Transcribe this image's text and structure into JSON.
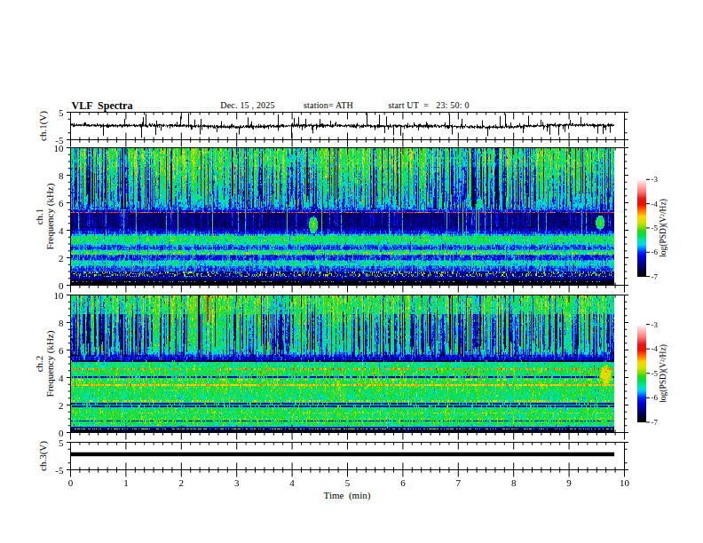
{
  "header": {
    "title": "VLF  Spectra",
    "date": "Dec. 15 , 2025",
    "station": "station= ATH",
    "start_ut": "start UT  =   23: 50: 0"
  },
  "x_axis": {
    "label": "Time  (min)",
    "min": 0,
    "max": 10,
    "tick_labels": [
      "0",
      "1",
      "2",
      "3",
      "4",
      "5",
      "6",
      "7",
      "8",
      "9",
      "10"
    ],
    "major_tick_interval_min": 1,
    "minor_ticks_per_major": 6,
    "data_end_min": 9.81
  },
  "panels": [
    {
      "id": "ch1-waveform",
      "ylabel": "ch.1(V)",
      "y_range": [
        -5,
        5
      ],
      "ytick_values": [
        5,
        -5
      ],
      "ytick_labels": [
        "5",
        "-5"
      ],
      "yminor_values": [
        2.5,
        -2.5
      ],
      "type": "line"
    },
    {
      "id": "ch1-spectrogram",
      "ylabel_lines": [
        "ch.1",
        "Frequency  (kHz)"
      ],
      "y_range": [
        0,
        10
      ],
      "ytick_values": [
        10,
        8,
        6,
        4,
        2,
        0
      ],
      "ytick_labels": [
        "10",
        "8",
        "6",
        "4",
        "2",
        "0"
      ],
      "yminor_interval_kHz": 0.5,
      "type": "heatmap"
    },
    {
      "id": "ch2-spectrogram",
      "ylabel_lines": [
        "ch.2",
        "Frequency  (kHz)"
      ],
      "y_range": [
        0,
        10
      ],
      "ytick_values": [
        10,
        8,
        6,
        4,
        2,
        0
      ],
      "ytick_labels": [
        "10",
        "8",
        "6",
        "4",
        "2",
        "0"
      ],
      "yminor_interval_kHz": 0.5,
      "type": "heatmap"
    },
    {
      "id": "ch3-waveform",
      "ylabel": "ch.3(V)",
      "y_range": [
        -5,
        5
      ],
      "ytick_values": [
        5,
        -5
      ],
      "ytick_labels": [
        "5",
        "-5"
      ],
      "yminor_values": [
        2.5,
        -2.5
      ],
      "type": "line"
    }
  ],
  "colorbars": [
    {
      "for_panel": "ch1-spectrogram",
      "label": "log(PSD)(V²/Hz)",
      "tick_values": [
        -3,
        -4,
        -5,
        -6,
        -7
      ],
      "tick_labels": [
        "-3",
        "-4",
        "-5",
        "-6",
        "-7"
      ],
      "range": [
        -7,
        -3
      ]
    },
    {
      "for_panel": "ch2-spectrogram",
      "label": "log(PSD)(V²/Hz)",
      "tick_values": [
        -3,
        -4,
        -5,
        -6,
        -7
      ],
      "tick_labels": [
        "-3",
        "-4",
        "-5",
        "-6",
        "-7"
      ],
      "range": [
        -7,
        -3
      ]
    }
  ],
  "colormap": {
    "range": [
      -7,
      -3
    ],
    "stops": [
      [
        0.0,
        "#000000"
      ],
      [
        0.06,
        "#02003c"
      ],
      [
        0.125,
        "#000085"
      ],
      [
        0.2,
        "#0000e0"
      ],
      [
        0.25,
        "#0028ff"
      ],
      [
        0.3,
        "#00a0ff"
      ],
      [
        0.33,
        "#00d8f0"
      ],
      [
        0.375,
        "#00e8a0"
      ],
      [
        0.425,
        "#00e050"
      ],
      [
        0.475,
        "#30d818"
      ],
      [
        0.5,
        "#78dc00"
      ],
      [
        0.563,
        "#d8e400"
      ],
      [
        0.625,
        "#ffd000"
      ],
      [
        0.65,
        "#ffa000"
      ],
      [
        0.7,
        "#ff5000"
      ],
      [
        0.74,
        "#f01000"
      ],
      [
        0.8,
        "#e01818"
      ],
      [
        0.875,
        "#ff7878"
      ],
      [
        0.95,
        "#ffc0c0"
      ],
      [
        1.0,
        "#fff8f8"
      ]
    ]
  },
  "chart_data": [
    {
      "id": "ch1-waveform",
      "type": "line",
      "x_range_min": [
        0,
        10
      ],
      "data_duration_min": 9.81,
      "y_range_V": [
        -5,
        5
      ],
      "baseline_mean_V": 0,
      "noise_sigma_V": 0.3,
      "baseline_wander": [
        {
          "amp_V": 0.28,
          "period_min": 4.7,
          "phase": 1.0
        },
        {
          "amp_V": 0.18,
          "period_min": 2.3,
          "phase": 2.5
        },
        {
          "amp_V": 0.12,
          "period_min": 7.9,
          "phase": 0.3
        }
      ],
      "random_spike_rate_per_min": 13,
      "major_spikes": [
        {
          "t": 1.26,
          "v": -4.5
        },
        {
          "t": 1.35,
          "v": 4.6
        },
        {
          "t": 1.53,
          "v": -3.4
        },
        {
          "t": 2.11,
          "v": 4.8
        },
        {
          "t": 3.03,
          "v": -3.2
        },
        {
          "t": 3.73,
          "v": 4.4
        },
        {
          "t": 3.98,
          "v": -4.6
        },
        {
          "t": 5.33,
          "v": 4.9
        },
        {
          "t": 5.56,
          "v": 4.3
        },
        {
          "t": 5.94,
          "v": -3.6
        },
        {
          "t": 6.82,
          "v": 4.5
        },
        {
          "t": 6.88,
          "v": -3.2
        },
        {
          "t": 7.52,
          "v": -3.8
        },
        {
          "t": 7.84,
          "v": 4.6
        },
        {
          "t": 8.25,
          "v": 3.9
        },
        {
          "t": 8.8,
          "v": -3.5
        },
        {
          "t": 9.2,
          "v": 3.4
        },
        {
          "t": 9.5,
          "v": -2.8
        }
      ]
    },
    {
      "id": "ch1-spectrogram",
      "type": "heatmap",
      "x_range_min": [
        0,
        10
      ],
      "data_duration_min": 9.81,
      "y_range_kHz": [
        0,
        10
      ],
      "z_range_log_psd": [
        -7,
        -3
      ],
      "background_profile_f_v": [
        [
          0.0,
          -7.0
        ],
        [
          0.18,
          -7.0
        ],
        [
          0.32,
          -6.85
        ],
        [
          0.45,
          -6.55
        ],
        [
          0.55,
          -6.3
        ],
        [
          0.62,
          -6.15
        ],
        [
          0.75,
          -6.0
        ],
        [
          0.95,
          -5.95
        ],
        [
          1.12,
          -6.0
        ],
        [
          1.3,
          -5.9
        ],
        [
          1.5,
          -5.55
        ],
        [
          1.7,
          -5.6
        ],
        [
          1.9,
          -6.05
        ],
        [
          2.15,
          -6.05
        ],
        [
          2.3,
          -5.45
        ],
        [
          2.45,
          -5.4
        ],
        [
          2.6,
          -5.95
        ],
        [
          2.8,
          -6.05
        ],
        [
          3.0,
          -5.5
        ],
        [
          3.4,
          -5.4
        ],
        [
          3.55,
          -5.35
        ],
        [
          3.7,
          -5.95
        ],
        [
          3.9,
          -6.15
        ],
        [
          4.1,
          -6.4
        ],
        [
          4.25,
          -6.55
        ],
        [
          5.25,
          -6.55
        ],
        [
          5.42,
          -6.1
        ],
        [
          5.6,
          -5.85
        ],
        [
          5.85,
          -5.65
        ],
        [
          6.15,
          -5.55
        ],
        [
          6.6,
          -5.4
        ],
        [
          7.2,
          -5.3
        ],
        [
          8.0,
          -5.15
        ],
        [
          8.7,
          -5.05
        ],
        [
          9.4,
          -5.0
        ],
        [
          10.0,
          -5.0
        ]
      ],
      "spectral_lines": [
        {
          "f": 5.3,
          "v": -4.2,
          "halfwidth_kHz": 0.03,
          "dash_fraction": 0.7
        },
        {
          "f": 3.52,
          "v": -5.25,
          "halfwidth_kHz": 0.05,
          "dash_fraction": 0.7
        },
        {
          "f": 3.3,
          "v": -5.1,
          "halfwidth_kHz": 0.07,
          "dash_fraction": 0.22
        },
        {
          "f": 2.35,
          "v": -4.95,
          "halfwidth_kHz": 0.1,
          "dash_fraction": 0.4
        },
        {
          "f": 0.27,
          "v": -4.9,
          "halfwidth_kHz": 0.06,
          "dash_fraction": 0.15
        }
      ],
      "dither_bands": [
        {
          "f_range": [
            0.55,
            0.95
          ],
          "v_low": -6.5,
          "v_high": -5.0,
          "p_high": 0.25
        }
      ],
      "sferic_streaks": {
        "column_probability": 0.56,
        "dv_range": [
          -1.75,
          -0.4
        ],
        "bright_fraction": 0.04,
        "dark_band_kHz": [
          4.25,
          5.35
        ],
        "dark_band_lighten_dv": 0.45,
        "whistler_probability": 0.03,
        "whistler_level": -5.4,
        "whistler_extent_kHz": [
          2.6,
          5.9
        ]
      },
      "features": [
        {
          "type": "blob",
          "t": 4.37,
          "f": 4.4,
          "dt_min": 0.06,
          "df_kHz": 0.45,
          "v": -5.0
        },
        {
          "type": "blob",
          "t": 9.55,
          "f": 4.55,
          "dt_min": 0.06,
          "df_kHz": 0.4,
          "v": -5.1
        }
      ],
      "noise_sigma": 0.27
    },
    {
      "id": "ch2-spectrogram",
      "type": "heatmap",
      "x_range_min": [
        0,
        10
      ],
      "data_duration_min": 9.81,
      "y_range_kHz": [
        0,
        10
      ],
      "z_range_log_psd": [
        -7,
        -3
      ],
      "background_profile_f_v": [
        [
          0.0,
          -7.0
        ],
        [
          0.12,
          -6.95
        ],
        [
          0.22,
          -6.6
        ],
        [
          0.32,
          -6.6
        ],
        [
          0.42,
          -5.6
        ],
        [
          0.55,
          -5.3
        ],
        [
          0.75,
          -5.25
        ],
        [
          0.95,
          -5.25
        ],
        [
          1.2,
          -5.3
        ],
        [
          1.5,
          -5.25
        ],
        [
          1.75,
          -5.35
        ],
        [
          1.9,
          -5.3
        ],
        [
          2.05,
          -5.35
        ],
        [
          2.2,
          -5.3
        ],
        [
          2.5,
          -5.35
        ],
        [
          2.8,
          -5.3
        ],
        [
          3.1,
          -5.25
        ],
        [
          3.45,
          -5.2
        ],
        [
          3.8,
          -5.2
        ],
        [
          4.0,
          -5.5
        ],
        [
          4.15,
          -5.3
        ],
        [
          4.35,
          -5.25
        ],
        [
          4.55,
          -5.25
        ],
        [
          4.78,
          -5.4
        ],
        [
          4.88,
          -5.3
        ],
        [
          4.97,
          -5.5
        ],
        [
          5.08,
          -5.3
        ],
        [
          5.2,
          -6.3
        ],
        [
          5.45,
          -6.3
        ],
        [
          5.65,
          -5.9
        ],
        [
          5.85,
          -5.6
        ],
        [
          6.1,
          -5.45
        ],
        [
          6.5,
          -5.4
        ],
        [
          7.0,
          -5.35
        ],
        [
          7.6,
          -5.3
        ],
        [
          8.2,
          -5.2
        ],
        [
          8.8,
          -5.1
        ],
        [
          9.4,
          -5.05
        ],
        [
          10.0,
          -5.0
        ]
      ],
      "spectral_lines": [
        {
          "f": 5.18,
          "v": -6.9,
          "halfwidth_kHz": 0.05,
          "dash_fraction": 0.8
        },
        {
          "f": 4.95,
          "v": -6.5,
          "halfwidth_kHz": 0.04,
          "dash_fraction": 0.6
        },
        {
          "f": 4.65,
          "v": -4.35,
          "halfwidth_kHz": 0.04,
          "dash_fraction": 0.45
        },
        {
          "f": 4.3,
          "v": -4.25,
          "halfwidth_kHz": 0.18,
          "dash_fraction": 0.025
        },
        {
          "f": 4.02,
          "v": -6.3,
          "halfwidth_kHz": 0.04,
          "dash_fraction": 0.7
        },
        {
          "f": 3.45,
          "v": -4.5,
          "halfwidth_kHz": 0.08,
          "dash_fraction": 0.85
        },
        {
          "f": 3.8,
          "v": -4.6,
          "halfwidth_kHz": 0.04,
          "dash_fraction": 0.3
        },
        {
          "f": 2.3,
          "v": -4.8,
          "halfwidth_kHz": 0.06,
          "dash_fraction": 0.4
        },
        {
          "f": 2.08,
          "v": -6.3,
          "halfwidth_kHz": 0.05,
          "dash_fraction": 0.85
        },
        {
          "f": 1.85,
          "v": -6.35,
          "halfwidth_kHz": 0.05,
          "dash_fraction": 0.85
        },
        {
          "f": 1.42,
          "v": -4.8,
          "halfwidth_kHz": 0.05,
          "dash_fraction": 0.35
        },
        {
          "f": 1.0,
          "v": -4.9,
          "halfwidth_kHz": 0.05,
          "dash_fraction": 0.3
        },
        {
          "f": 0.85,
          "v": -6.3,
          "halfwidth_kHz": 0.05,
          "dash_fraction": 0.6
        },
        {
          "f": 0.22,
          "v": -4.9,
          "halfwidth_kHz": 0.06,
          "dash_fraction": 0.5
        }
      ],
      "dither_bands": [],
      "sferic_streaks": {
        "column_probability": 0.55,
        "dv_range": [
          -1.8,
          -0.5
        ],
        "bright_fraction": 0.03,
        "dark_band_kHz": [
          5.2,
          5.6
        ],
        "dark_band_lighten_dv": 0.3,
        "whistler_probability": 0.03,
        "whistler_level": -5.5,
        "whistler_extent_kHz": [
          2.5,
          5.2
        ]
      },
      "features": [
        {
          "type": "vertical_line",
          "t": 2.46,
          "f_range": [
            8.1,
            10
          ],
          "v": -3.85
        },
        {
          "type": "vertical_line",
          "t": 6.83,
          "f_range": [
            5.6,
            10
          ],
          "v": -6.9
        },
        {
          "type": "vertical_line",
          "t": 6.88,
          "f_range": [
            5.6,
            10
          ],
          "v": -6.8
        },
        {
          "type": "vertical_line",
          "t": 2.3,
          "f_range": [
            6.0,
            10
          ],
          "v": -6.7
        },
        {
          "type": "blob",
          "t": 9.65,
          "f": 4.2,
          "dt_min": 0.09,
          "df_kHz": 0.55,
          "v": -4.55
        }
      ],
      "noise_sigma": 0.27
    },
    {
      "id": "ch3-waveform",
      "type": "line",
      "x_range_min": [
        0,
        10
      ],
      "data_duration_min": 9.81,
      "y_range_V": [
        -5,
        5
      ],
      "constant_value_V": 0.65,
      "trace_halfwidth_V": 0.72
    }
  ]
}
